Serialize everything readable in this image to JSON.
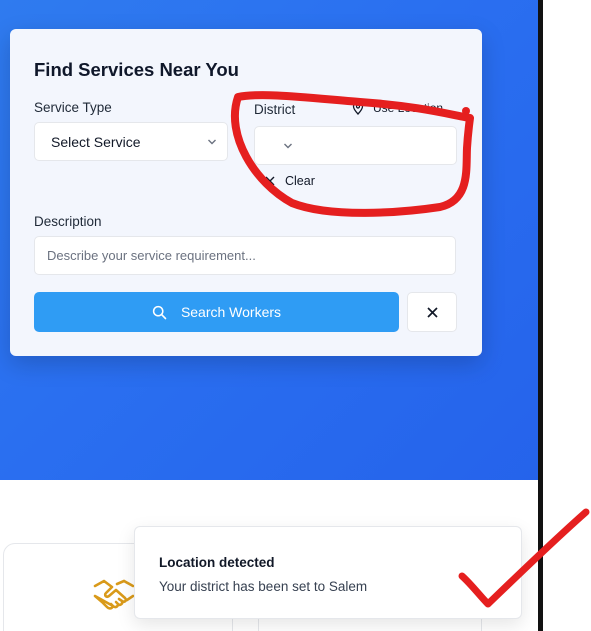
{
  "finder": {
    "title": "Find Services Near You",
    "service_type_label": "Service Type",
    "service_type_value": "Select Service",
    "district_label": "District",
    "use_location_label": "Use Location",
    "district_value": "",
    "clear_label": "Clear",
    "description_label": "Description",
    "description_placeholder": "Describe your service requirement...",
    "search_button": "Search Workers"
  },
  "toast": {
    "title": "Location detected",
    "message": "Your district has been set to Salem"
  },
  "icons": {
    "search": "search-icon",
    "close": "close-icon",
    "location": "map-pin-icon",
    "handshake": "handshake-icon",
    "chevron": "chevron-down-icon",
    "check_mark": "checkmark-annotation"
  },
  "colors": {
    "hero_blue": "#2a6ff0",
    "primary_button": "#2f9cf4",
    "annotation_red": "#e51f1f",
    "handshake_gold": "#d99a1a"
  }
}
